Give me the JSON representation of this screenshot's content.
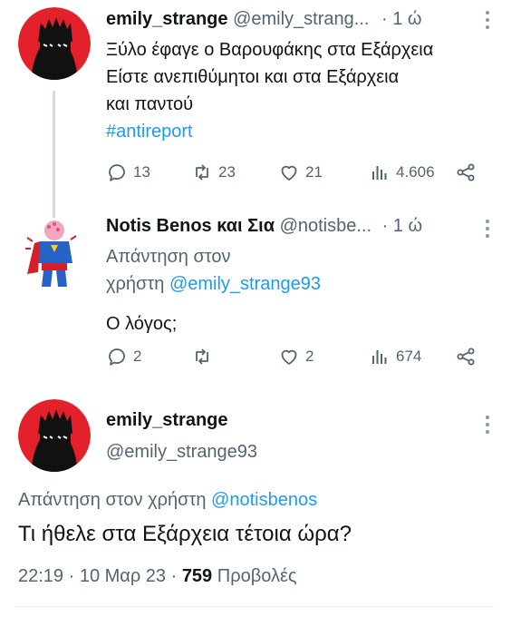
{
  "tweet1": {
    "display_name": "emily_strange",
    "handle": "@emily_strang...",
    "time": "· 1 ώ",
    "lines": [
      "Ξύλο έφαγε ο Βαρουφάκης στα Εξάρχεια",
      "Είστε ανεπιθύμητοι και στα Εξάρχεια",
      "και παντού"
    ],
    "hashtag": "#antireport",
    "stats": {
      "replies": "13",
      "retweets": "23",
      "likes": "21",
      "views": "4.606"
    }
  },
  "tweet2": {
    "display_name": "Notis Benos και Σια",
    "handle": "@notisbe...",
    "time": "· 1 ώ",
    "reply_line1": "Απάντηση στον",
    "reply_prefix": "χρήστη",
    "reply_to": "@emily_strange93",
    "text": "Ο λόγος;",
    "stats": {
      "replies": "2",
      "retweets": "",
      "likes": "2",
      "views": "674"
    }
  },
  "focus": {
    "display_name": "emily_strange",
    "handle": "@emily_strange93",
    "reply_prefix": "Απάντηση στον χρήστη",
    "reply_to": "@notisbenos",
    "text": "Τι ήθελε στα Εξάρχεια τέτοια ώρα?",
    "meta_time": "22:19 · 10 Μαρ 23 ·",
    "views_count": "759",
    "views_label": "Προβολές"
  },
  "colors": {
    "link": "#1d9bf0",
    "muted": "#536471",
    "text": "#0f1419",
    "avatar_bg": "#e4202b"
  }
}
